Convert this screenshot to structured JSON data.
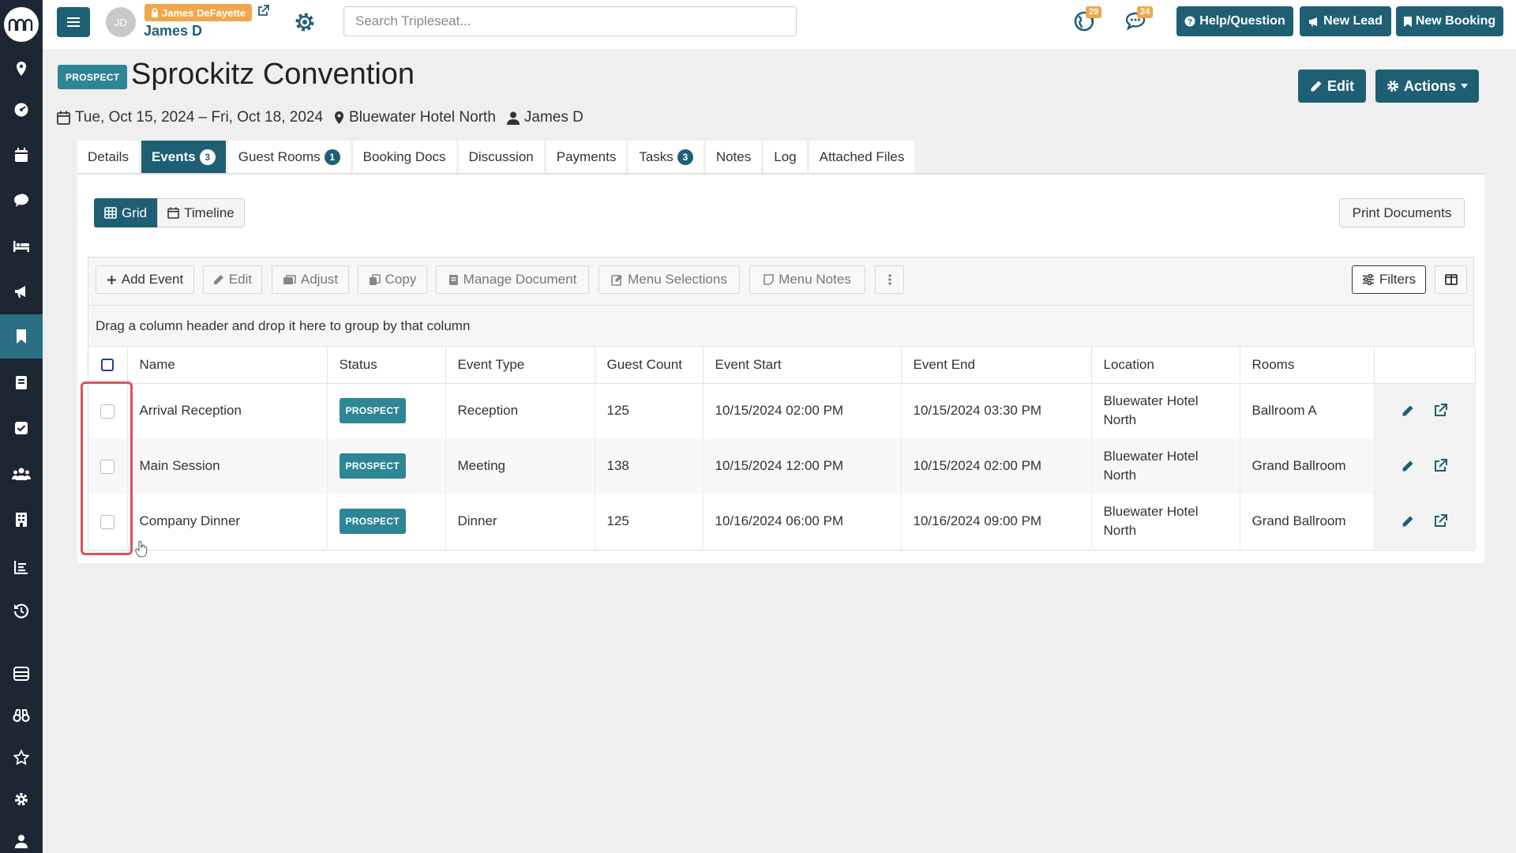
{
  "colors": {
    "primary": "#1f5f74",
    "teal": "#2e8596",
    "orange": "#f0a64b",
    "sidebar": "#1d2633",
    "highlight": "#e0505a"
  },
  "sidebar": {
    "items": [
      {
        "icon": "map-pin-icon"
      },
      {
        "icon": "dashboard-icon"
      },
      {
        "icon": "calendar-icon"
      },
      {
        "icon": "chat-icon"
      },
      {
        "icon": "bed-icon"
      },
      {
        "icon": "megaphone-icon"
      },
      {
        "icon": "bookmark-icon",
        "active": true
      },
      {
        "icon": "document-icon"
      },
      {
        "icon": "checkbox-icon"
      },
      {
        "icon": "users-icon"
      },
      {
        "icon": "building-icon"
      },
      {
        "icon": "report-icon"
      },
      {
        "icon": "history-icon"
      },
      {
        "icon": "database-icon"
      },
      {
        "icon": "binoculars-icon"
      },
      {
        "icon": "star-icon"
      },
      {
        "icon": "settings-icon"
      },
      {
        "icon": "user-icon"
      }
    ]
  },
  "topbar": {
    "avatar_initials": "JD",
    "impersonating": "James DeFayette",
    "user_name": "James D",
    "search_placeholder": "Search Tripleseat...",
    "notifications_count": "29",
    "messages_count": "24",
    "help_label": "Help/Question",
    "new_lead_label": "New Lead",
    "new_booking_label": "New Booking"
  },
  "booking": {
    "status_tag": "PROSPECT",
    "title": "Sprockitz Convention",
    "dates": "Tue, Oct 15, 2024 – Fri, Oct 18, 2024",
    "location": "Bluewater Hotel North",
    "owner": "James D",
    "edit_label": "Edit",
    "actions_label": "Actions"
  },
  "tabs": [
    {
      "label": "Details",
      "count": null,
      "active": false
    },
    {
      "label": "Events",
      "count": "3",
      "active": true
    },
    {
      "label": "Guest Rooms",
      "count": "1",
      "active": false
    },
    {
      "label": "Booking Docs",
      "count": null,
      "active": false
    },
    {
      "label": "Discussion",
      "count": null,
      "active": false
    },
    {
      "label": "Payments",
      "count": null,
      "active": false
    },
    {
      "label": "Tasks",
      "count": "3",
      "active": false
    },
    {
      "label": "Notes",
      "count": null,
      "active": false
    },
    {
      "label": "Log",
      "count": null,
      "active": false
    },
    {
      "label": "Attached Files",
      "count": null,
      "active": false
    }
  ],
  "events_panel": {
    "view_grid": "Grid",
    "view_timeline": "Timeline",
    "print_label": "Print Documents",
    "toolbar": {
      "add_event": "Add Event",
      "edit": "Edit",
      "adjust": "Adjust",
      "copy": "Copy",
      "manage_document": "Manage Document",
      "menu_selections": "Menu Selections",
      "menu_notes": "Menu Notes",
      "filters": "Filters"
    },
    "group_hint": "Drag a column header and drop it here to group by that column",
    "columns": [
      "Name",
      "Status",
      "Event Type",
      "Guest Count",
      "Event Start",
      "Event End",
      "Location",
      "Rooms"
    ],
    "rows": [
      {
        "name": "Arrival Reception",
        "status": "PROSPECT",
        "type": "Reception",
        "guests": "125",
        "start": "10/15/2024 02:00 PM",
        "end": "10/15/2024 03:30 PM",
        "location": "Bluewater Hotel North",
        "rooms": "Ballroom A"
      },
      {
        "name": "Main Session",
        "status": "PROSPECT",
        "type": "Meeting",
        "guests": "138",
        "start": "10/15/2024 12:00 PM",
        "end": "10/15/2024 02:00 PM",
        "location": "Bluewater Hotel North",
        "rooms": "Grand Ballroom"
      },
      {
        "name": "Company Dinner",
        "status": "PROSPECT",
        "type": "Dinner",
        "guests": "125",
        "start": "10/16/2024 06:00 PM",
        "end": "10/16/2024 09:00 PM",
        "location": "Bluewater Hotel North",
        "rooms": "Grand Ballroom"
      }
    ]
  }
}
